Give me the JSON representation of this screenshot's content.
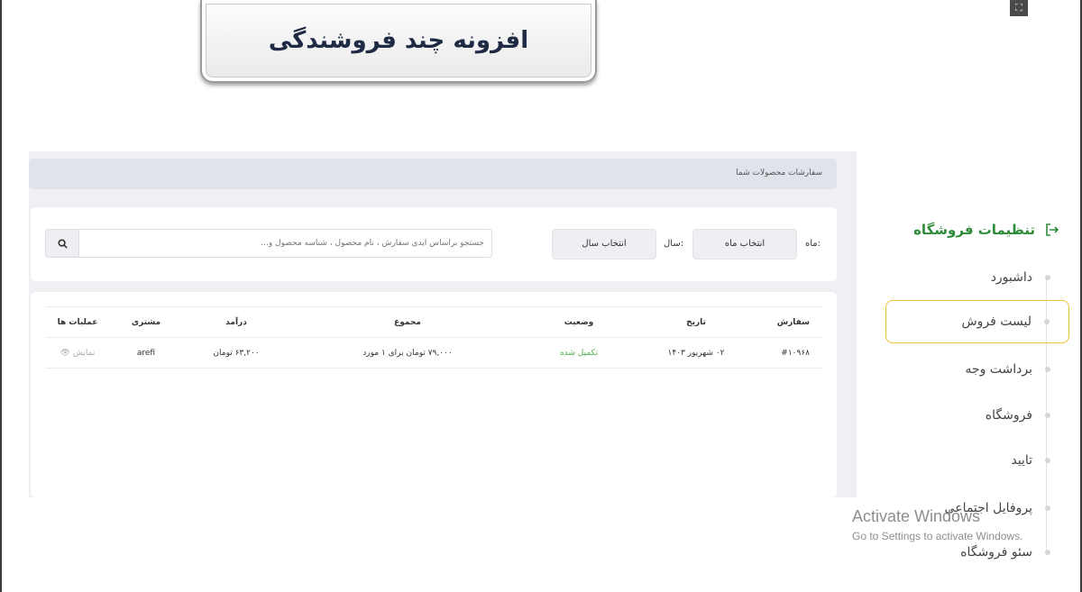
{
  "banner": {
    "title": "افزونه چند فروشندگی"
  },
  "panel": {
    "breadcrumb": "سفارشات محصولات شما",
    "filters": {
      "month_label": "ماه:",
      "month_select": "انتخاب ماه",
      "year_label": "سال:",
      "year_select": "انتخاب سال",
      "search_placeholder": "جستجو براساس آیدی سفارش ، نام محصول ، شناسه محصول و..."
    },
    "table": {
      "headers": {
        "order": "سفارش",
        "date": "تاریخ",
        "status": "وضعیت",
        "total": "مجموع",
        "income": "درآمد",
        "customer": "مشتری",
        "actions": "عملیات ها"
      },
      "rows": [
        {
          "order": "#۱۰۹۶۸",
          "date": "۰۲ شهریور ۱۴۰۳",
          "status": "تکمیل شده",
          "total": "۷۹,۰۰۰ تومان برای ۱ مورد",
          "income": "۶۳,۲۰۰ تومان",
          "customer": "arefi",
          "action": "نمایش"
        }
      ]
    }
  },
  "sidebar": {
    "title": "تنظیمات فروشگاه",
    "items": [
      {
        "label": "داشبورد"
      },
      {
        "label": "لیست فروش",
        "active": true
      },
      {
        "label": "برداشت وجه"
      },
      {
        "label": "فروشگاه"
      },
      {
        "label": "تایید"
      },
      {
        "label": "پروفایل اجتماعی"
      },
      {
        "label": "سئو فروشگاه"
      }
    ]
  },
  "watermark": {
    "title": "Activate Windows",
    "subtitle": "Go to Settings to activate Windows."
  },
  "colors": {
    "accent_green": "#2e8b3a",
    "status_green": "#4caf50",
    "active_outline": "#f1c232"
  }
}
